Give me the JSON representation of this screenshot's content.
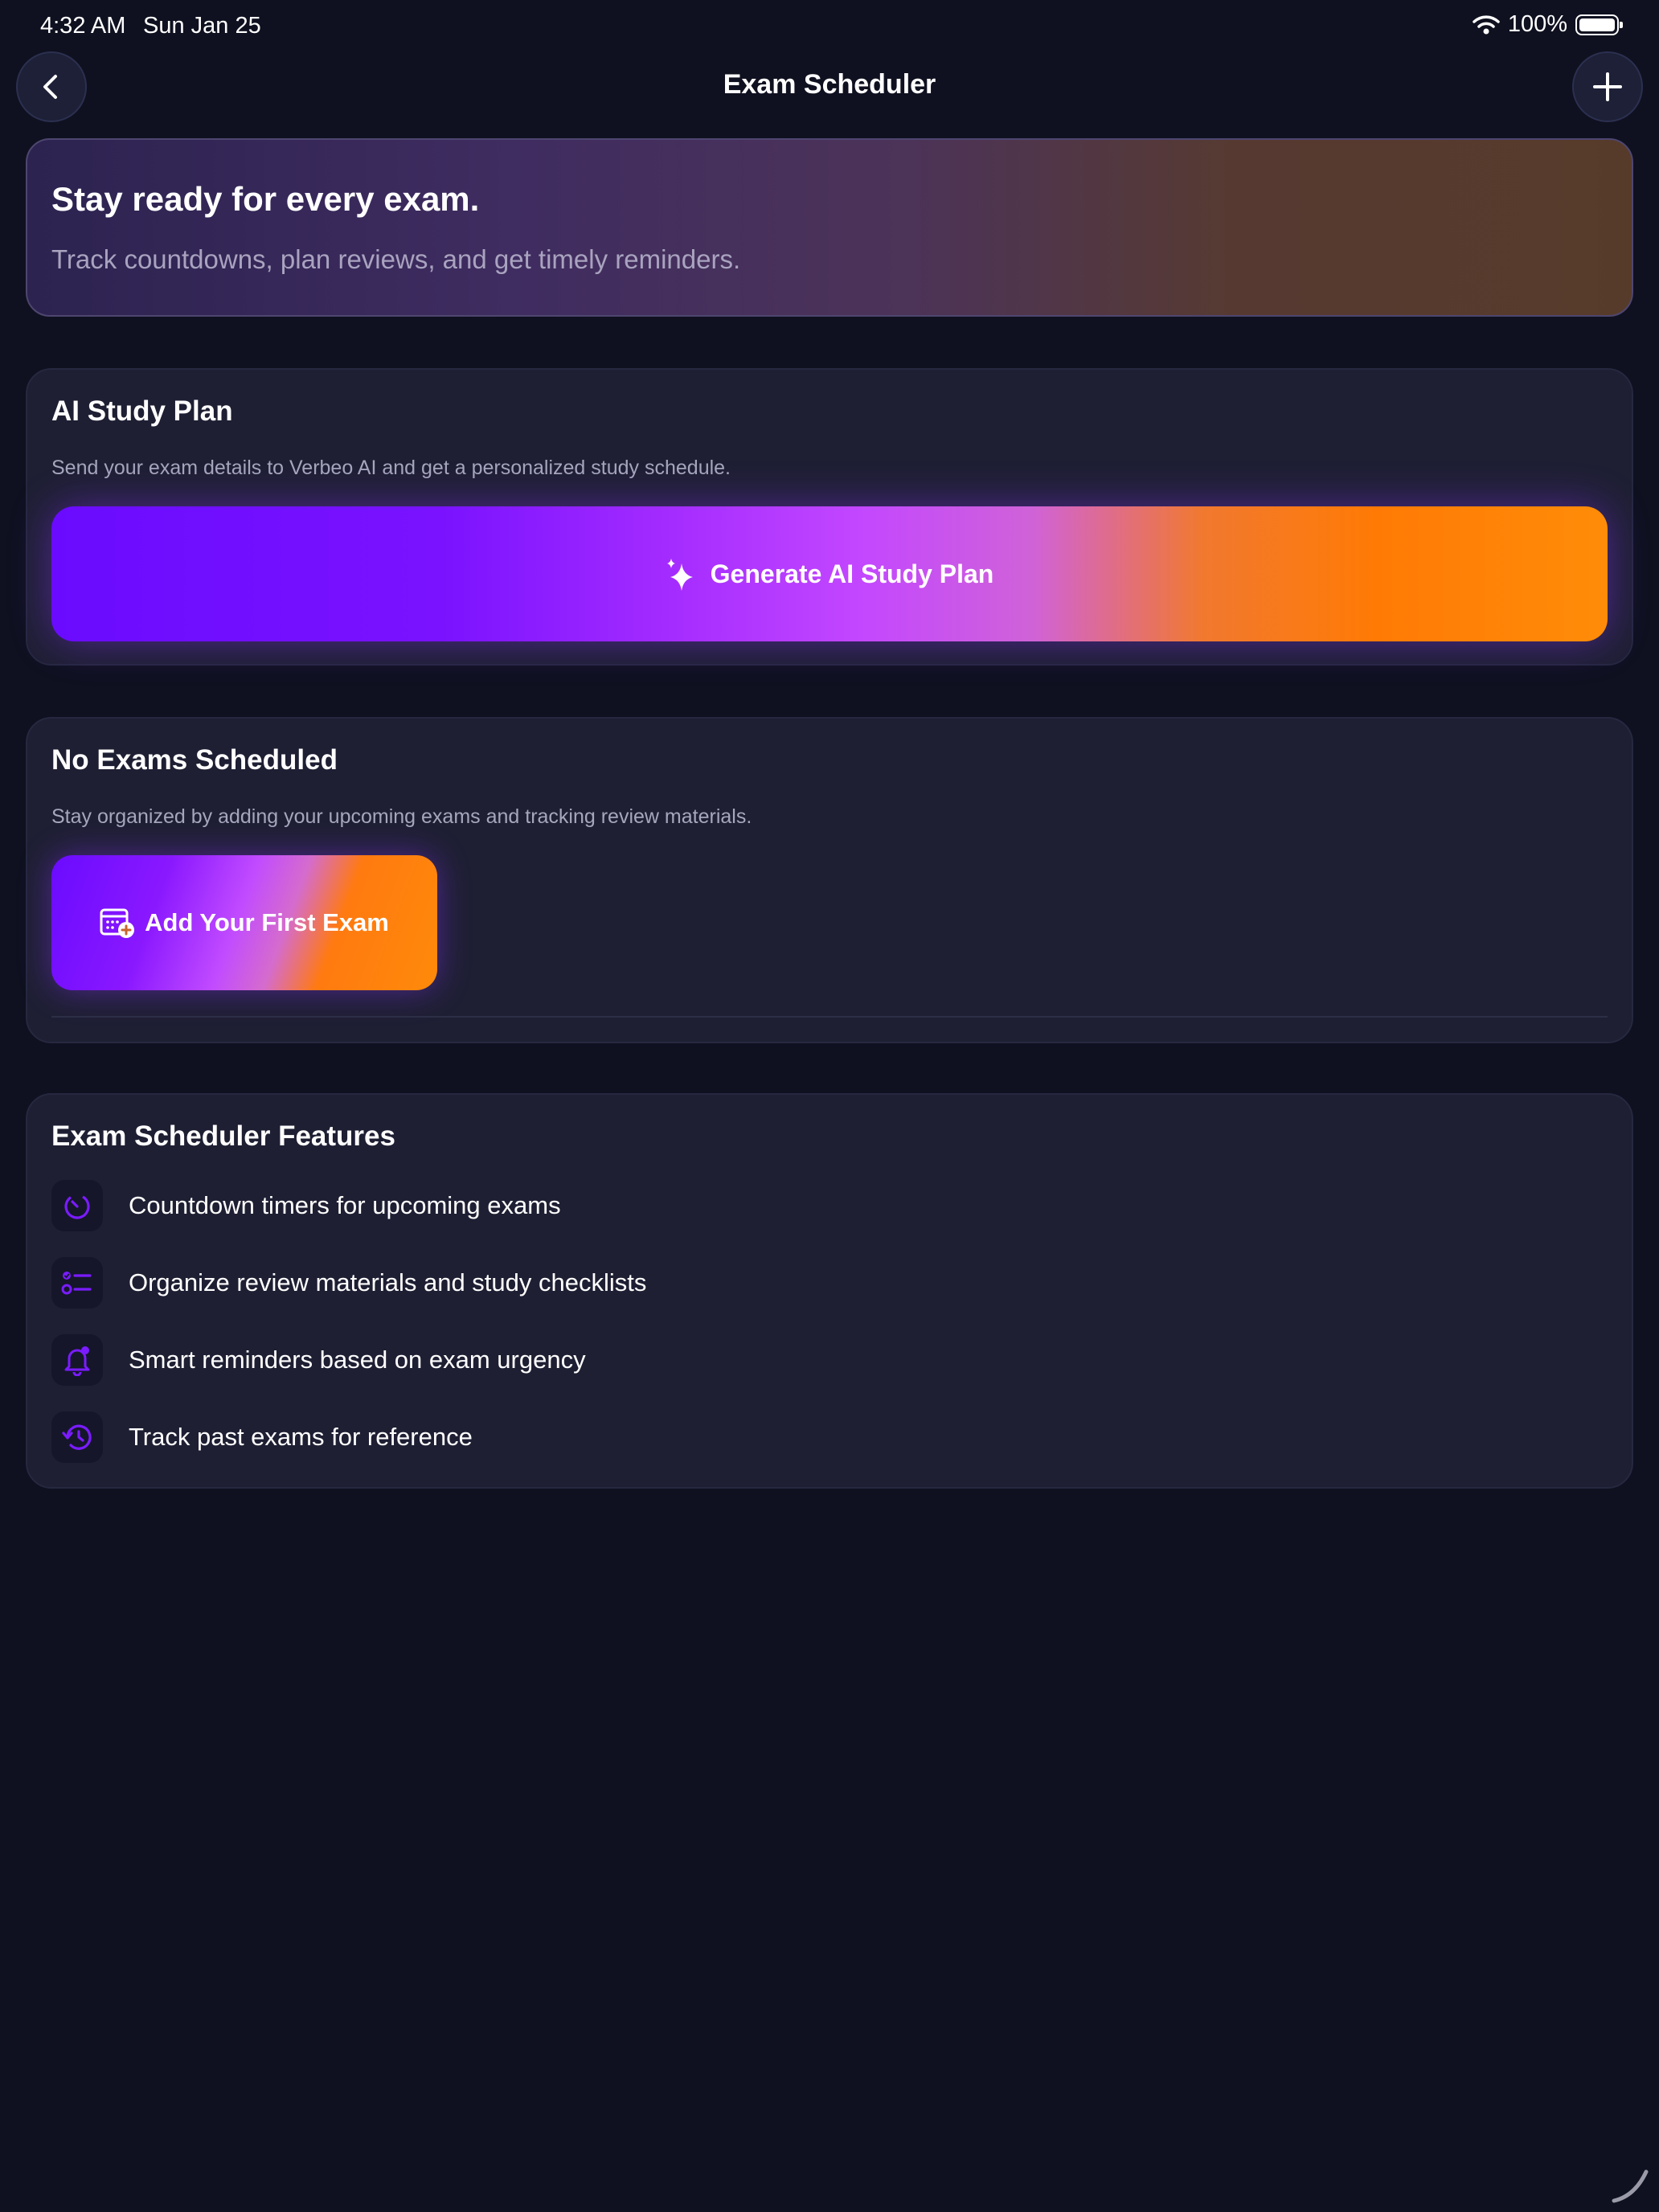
{
  "status_bar": {
    "time": "4:32 AM",
    "date": "Sun Jan 25",
    "battery": "100%"
  },
  "nav": {
    "title": "Exam Scheduler",
    "back_icon": "chevron-left-icon",
    "add_icon": "plus-icon"
  },
  "hero": {
    "title": "Stay ready for every exam.",
    "subtitle": "Track countdowns, plan reviews, and get timely reminders."
  },
  "ai_plan": {
    "title": "AI Study Plan",
    "description": "Send your exam details to Verbeo AI and get a personalized study schedule.",
    "button_label": "Generate AI Study Plan",
    "button_icon": "sparkles-icon"
  },
  "empty_state": {
    "title": "No Exams Scheduled",
    "description": "Stay organized by adding your upcoming exams and tracking review materials.",
    "button_label": "Add Your First Exam",
    "button_icon": "calendar-add-icon"
  },
  "features": {
    "title": "Exam Scheduler Features",
    "items": [
      {
        "icon": "timer-icon",
        "label": "Countdown timers for upcoming exams"
      },
      {
        "icon": "checklist-icon",
        "label": "Organize review materials and study checklists"
      },
      {
        "icon": "bell-icon",
        "label": "Smart reminders based on exam urgency"
      },
      {
        "icon": "history-icon",
        "label": "Track past exams for reference"
      }
    ]
  },
  "colors": {
    "background": "#0f1120",
    "card": "#1e1f33",
    "accent_purple": "#6a0bff",
    "accent_orange": "#ff8c08"
  }
}
